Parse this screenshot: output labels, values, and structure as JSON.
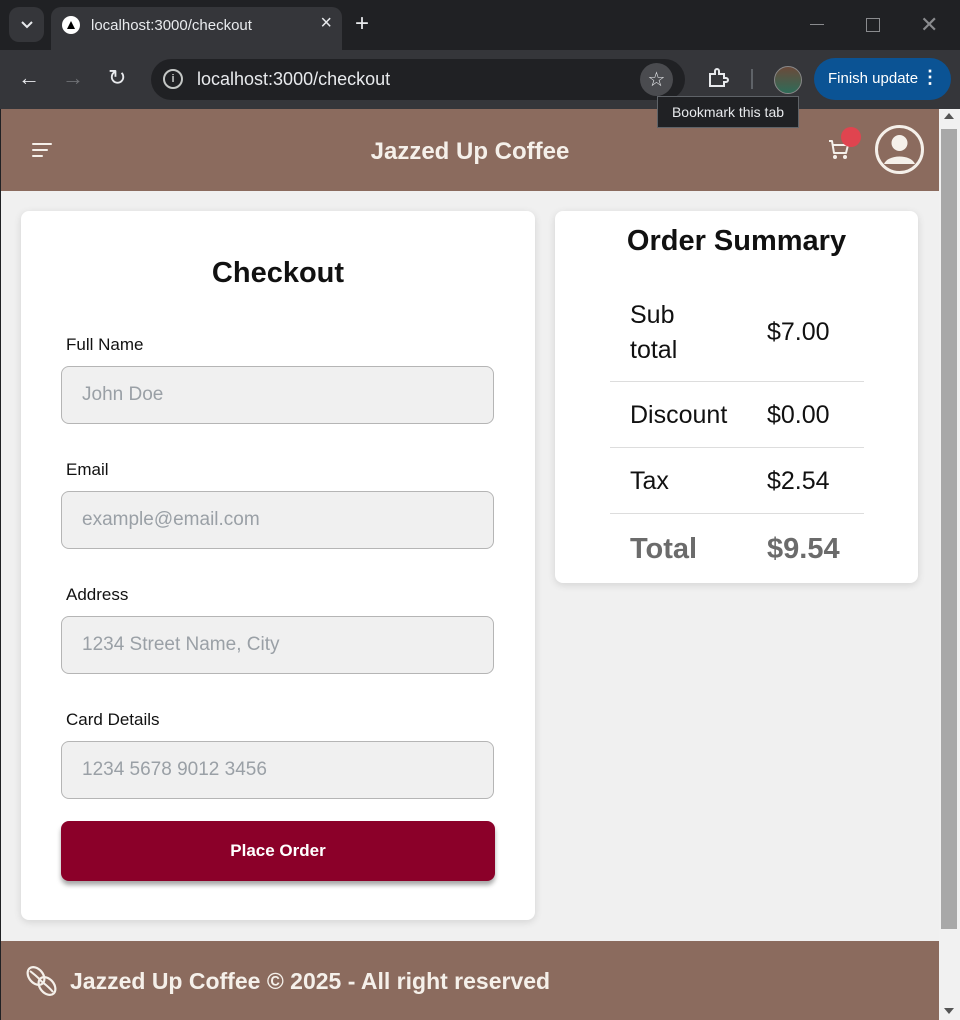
{
  "browser": {
    "tab_title": "localhost:3000/checkout",
    "url": "localhost:3000/checkout",
    "update_button": "Finish update",
    "tooltip": "Bookmark this tab"
  },
  "header": {
    "title": "Jazzed Up Coffee",
    "cart_badge_color": "#e0444f"
  },
  "checkout": {
    "title": "Checkout",
    "fields": [
      {
        "label": "Full Name",
        "placeholder": "John Doe"
      },
      {
        "label": "Email",
        "placeholder": "example@email.com"
      },
      {
        "label": "Address",
        "placeholder": "1234 Street Name, City"
      },
      {
        "label": "Card Details",
        "placeholder": "1234 5678 9012 3456"
      }
    ],
    "submit_label": "Place Order"
  },
  "summary": {
    "title": "Order Summary",
    "rows": [
      {
        "label": "Sub\ntotal",
        "value": "$7.00"
      },
      {
        "label": "Discount",
        "value": "$0.00"
      },
      {
        "label": "Tax",
        "value": "$2.54"
      },
      {
        "label": "Total",
        "value": "$9.54"
      }
    ]
  },
  "footer": {
    "text": "Jazzed Up Coffee © 2025 - All right reserved"
  },
  "colors": {
    "header_bg": "#8b6b5e",
    "primary_button": "#8b0029",
    "page_bg": "#f0f0f0"
  }
}
